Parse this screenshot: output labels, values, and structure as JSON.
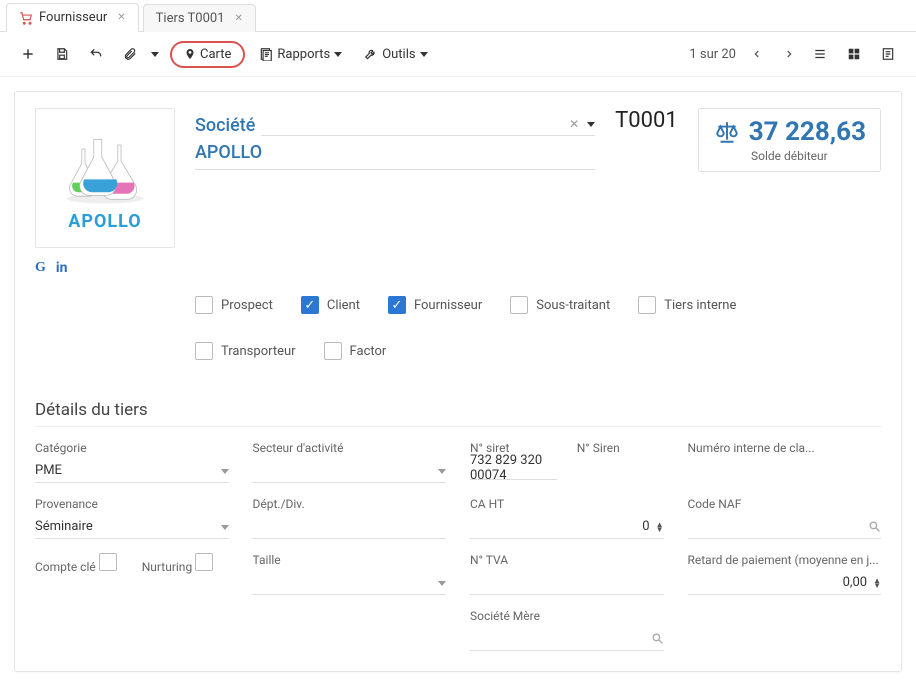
{
  "tabs": {
    "supplier": "Fournisseur",
    "tier": "Tiers T0001"
  },
  "toolbar": {
    "carte": "Carte",
    "rapports": "Rapports",
    "outils": "Outils",
    "pager": "1 sur 20"
  },
  "header": {
    "company_label": "Société",
    "company_name": "APOLLO",
    "logo_text": "APOLLO",
    "code": "T0001",
    "balance_value": "37 228,63",
    "balance_label": "Solde débiteur"
  },
  "checks": {
    "prospect": {
      "label": "Prospect",
      "checked": false
    },
    "client": {
      "label": "Client",
      "checked": true
    },
    "fournisseur": {
      "label": "Fournisseur",
      "checked": true
    },
    "sous_traitant": {
      "label": "Sous-traitant",
      "checked": false
    },
    "tiers_interne": {
      "label": "Tiers interne",
      "checked": false
    },
    "transporteur": {
      "label": "Transporteur",
      "checked": false
    },
    "factor": {
      "label": "Factor",
      "checked": false
    }
  },
  "details": {
    "section_title": "Détails du tiers",
    "categorie": {
      "label": "Catégorie",
      "value": "PME"
    },
    "secteur": {
      "label": "Secteur d'activité",
      "value": ""
    },
    "siret": {
      "label": "N° siret",
      "value": "732 829 320 00074"
    },
    "siren": {
      "label": "N° Siren",
      "value": ""
    },
    "num_interne": {
      "label": "Numéro interne de cla...",
      "value": ""
    },
    "provenance": {
      "label": "Provenance",
      "value": "Séminaire"
    },
    "dept": {
      "label": "Dépt./Div.",
      "value": ""
    },
    "ca_ht": {
      "label": "CA HT",
      "value": "0"
    },
    "code_naf": {
      "label": "Code NAF",
      "value": ""
    },
    "compte_cle": {
      "label": "Compte clé",
      "checked": false
    },
    "nurturing": {
      "label": "Nurturing",
      "checked": false
    },
    "taille": {
      "label": "Taille",
      "value": ""
    },
    "tva": {
      "label": "N° TVA",
      "value": ""
    },
    "retard": {
      "label": "Retard de paiement (moyenne en j...",
      "value": "0,00"
    },
    "societe_mere": {
      "label": "Société Mère",
      "value": ""
    }
  }
}
